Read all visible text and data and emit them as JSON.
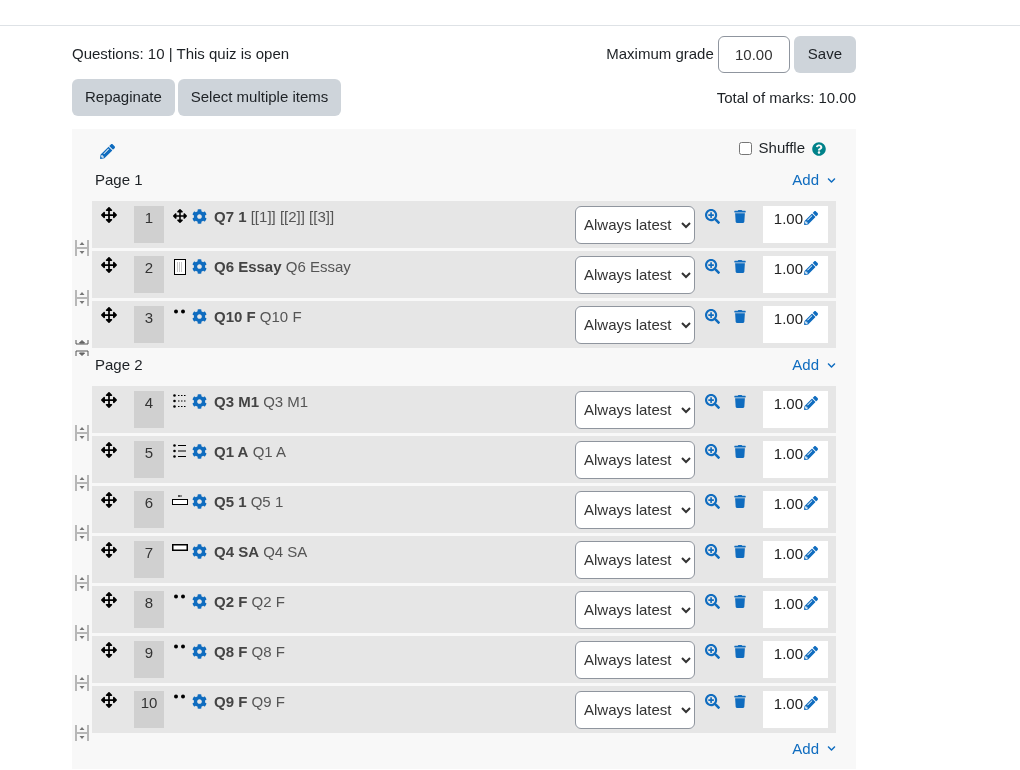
{
  "summary": "Questions: 10 | This quiz is open",
  "max_grade": {
    "label": "Maximum grade",
    "value": "10.00",
    "button": "Save"
  },
  "buttons": [
    "Repaginate",
    "Select multiple items"
  ],
  "total_marks": "Total of marks: 10.00",
  "shuffle": {
    "label": "Shuffle",
    "checked": false
  },
  "pages": [
    {
      "title": "Page 1",
      "add": "Add",
      "questions": [
        {
          "number": "1",
          "kind": "move",
          "name": "Q7 1",
          "text": "[[1]] [[2]] [[3]]",
          "behaviour": "Always latest",
          "mark": "1.00",
          "page_break": false
        },
        {
          "number": "2",
          "kind": "essay",
          "name": "Q6 Essay",
          "text": "Q6 Essay",
          "behaviour": "Always latest",
          "mark": "1.00",
          "page_break": false
        },
        {
          "number": "3",
          "kind": "dots",
          "name": "Q10 F",
          "text": "Q10 F",
          "behaviour": "Always latest",
          "mark": "1.00",
          "page_break": true
        }
      ]
    },
    {
      "title": "Page 2",
      "add": "Add",
      "questions": [
        {
          "number": "4",
          "kind": "grid",
          "name": "Q3 M1",
          "text": "Q3 M1",
          "behaviour": "Always latest",
          "mark": "1.00",
          "page_break": false
        },
        {
          "number": "5",
          "kind": "list",
          "name": "Q1 A",
          "text": "Q1 A",
          "behaviour": "Always latest",
          "mark": "1.00",
          "page_break": false
        },
        {
          "number": "6",
          "kind": "numeric",
          "name": "Q5 1",
          "text": "Q5 1",
          "behaviour": "Always latest",
          "mark": "1.00",
          "page_break": false
        },
        {
          "number": "7",
          "kind": "shortanswer",
          "name": "Q4 SA",
          "text": "Q4 SA",
          "behaviour": "Always latest",
          "mark": "1.00",
          "page_break": false
        },
        {
          "number": "8",
          "kind": "dots",
          "name": "Q2 F",
          "text": "Q2 F",
          "behaviour": "Always latest",
          "mark": "1.00",
          "page_break": false
        },
        {
          "number": "9",
          "kind": "dots",
          "name": "Q8 F",
          "text": "Q8 F",
          "behaviour": "Always latest",
          "mark": "1.00",
          "page_break": false
        },
        {
          "number": "10",
          "kind": "dots",
          "name": "Q9 F",
          "text": "Q9 F",
          "behaviour": "Always latest",
          "mark": "1.00",
          "page_break": false
        }
      ]
    }
  ],
  "add_bottom": "Add"
}
